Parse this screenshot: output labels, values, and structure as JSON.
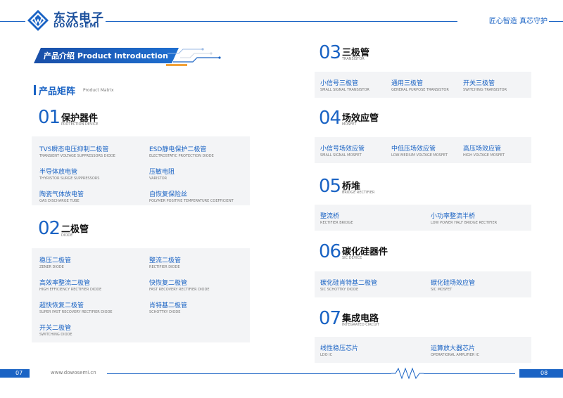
{
  "header": {
    "brand_cn": "东沃电子",
    "brand_en": "DOWOSEMI",
    "slogan": "匠心智造  真芯守护"
  },
  "intro": {
    "title": "产品介绍  Product Introduction"
  },
  "matrix": {
    "title_cn": "产品矩阵",
    "title_en": "Product Matrix"
  },
  "categories": [
    {
      "num": "01",
      "cn": "保护器件",
      "en": "PROTECTION DEVICE",
      "items": [
        {
          "cn": "TVS瞬态电压抑制二极管",
          "en": "TRANSIENT VOLTAGE SUPPRESSORS DIODE"
        },
        {
          "cn": "ESD静电保护二极管",
          "en": "ELECTROSTATIC PROTECTION DIODE"
        },
        {
          "cn": "半导体放电管",
          "en": "THYRISTOR SURGE SUPPRESSORS"
        },
        {
          "cn": "压敏电阻",
          "en": "VARISTOR"
        },
        {
          "cn": "陶瓷气体放电管",
          "en": "GAS DISCHARGE TUBE"
        },
        {
          "cn": "自恢复保险丝",
          "en": "POLYMER POSITIVE TEMPERATURE COEFFICIENT"
        }
      ]
    },
    {
      "num": "02",
      "cn": "二极管",
      "en": "DIODE",
      "items": [
        {
          "cn": "稳压二极管",
          "en": "ZENER DIODE"
        },
        {
          "cn": "整流二极管",
          "en": "RECTIFIER DIODE"
        },
        {
          "cn": "高效率整流二极管",
          "en": "HIGH EFFICIENCY RECTIFIER DIODE"
        },
        {
          "cn": "快恢复二极管",
          "en": "FAST RECOVERY RECTIFIER DIODE"
        },
        {
          "cn": "超快恢复二极管",
          "en": "SUPER FAST RECOVERY RECTIFIER DIODE"
        },
        {
          "cn": "肖特基二极管",
          "en": "SCHOTTKY DIODE"
        },
        {
          "cn": "开关二极管",
          "en": "SWITCHING DIODE"
        }
      ]
    },
    {
      "num": "03",
      "cn": "三极管",
      "en": "TRANSISTOR",
      "items": [
        {
          "cn": "小信号三极管",
          "en": "SMALL SIGNAL TRANSISTOR"
        },
        {
          "cn": "通用三极管",
          "en": "GENERAL PURPOSE TRANSISTOR"
        },
        {
          "cn": "开关三极管",
          "en": "SWITCHING TRANSISTOR"
        }
      ]
    },
    {
      "num": "04",
      "cn": "场效应管",
      "en": "MOSFET",
      "items": [
        {
          "cn": "小信号场效应管",
          "en": "SMALL SIGNAL MOSFET"
        },
        {
          "cn": "中低压场效应管",
          "en": "LOW-MEDIUM VOLTAGE MOSFET"
        },
        {
          "cn": "高压场效应管",
          "en": "HIGH VOLTAGE MOSFET"
        }
      ]
    },
    {
      "num": "05",
      "cn": "桥堆",
      "en": "BRIDGE RECTIFIER",
      "items": [
        {
          "cn": "整流桥",
          "en": "RECTIFIER BRIDGE"
        },
        {
          "cn": "小功率整流半桥",
          "en": "LOW POWER HALF BRIDGE RECTIFIER"
        }
      ]
    },
    {
      "num": "06",
      "cn": "碳化硅器件",
      "en": "SIC DEVICE",
      "items": [
        {
          "cn": "碳化硅肖特基二极管",
          "en": "SIC SCHOTTKY DIODE"
        },
        {
          "cn": "碳化硅场效应管",
          "en": "SIC MOSFET"
        }
      ]
    },
    {
      "num": "07",
      "cn": "集成电路",
      "en": "INTEGRATED CIRCUIT",
      "items": [
        {
          "cn": "线性稳压芯片",
          "en": "LDO IC"
        },
        {
          "cn": "运算放大器芯片",
          "en": "OPERATIONAL AMPLIFIER IC"
        }
      ]
    }
  ],
  "footer": {
    "page_left": "07",
    "page_right": "08",
    "url": "www.dowosemi.cn"
  }
}
